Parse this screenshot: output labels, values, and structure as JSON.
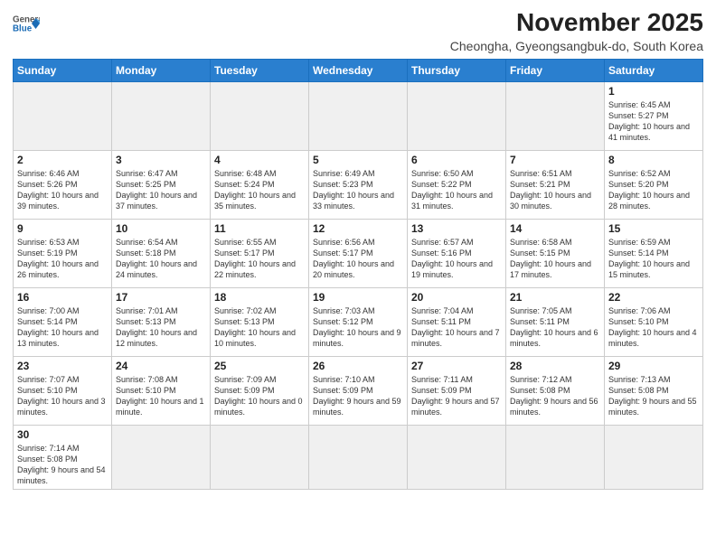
{
  "logo": {
    "general": "General",
    "blue": "Blue"
  },
  "header": {
    "month": "November 2025",
    "location": "Cheongha, Gyeongsangbuk-do, South Korea"
  },
  "weekdays": [
    "Sunday",
    "Monday",
    "Tuesday",
    "Wednesday",
    "Thursday",
    "Friday",
    "Saturday"
  ],
  "weeks": [
    [
      {
        "day": "",
        "empty": true
      },
      {
        "day": "",
        "empty": true
      },
      {
        "day": "",
        "empty": true
      },
      {
        "day": "",
        "empty": true
      },
      {
        "day": "",
        "empty": true
      },
      {
        "day": "",
        "empty": true
      },
      {
        "day": "1",
        "sunrise": "6:45 AM",
        "sunset": "5:27 PM",
        "daylight": "10 hours and 41 minutes."
      }
    ],
    [
      {
        "day": "2",
        "sunrise": "6:46 AM",
        "sunset": "5:26 PM",
        "daylight": "10 hours and 39 minutes."
      },
      {
        "day": "3",
        "sunrise": "6:47 AM",
        "sunset": "5:25 PM",
        "daylight": "10 hours and 37 minutes."
      },
      {
        "day": "4",
        "sunrise": "6:48 AM",
        "sunset": "5:24 PM",
        "daylight": "10 hours and 35 minutes."
      },
      {
        "day": "5",
        "sunrise": "6:49 AM",
        "sunset": "5:23 PM",
        "daylight": "10 hours and 33 minutes."
      },
      {
        "day": "6",
        "sunrise": "6:50 AM",
        "sunset": "5:22 PM",
        "daylight": "10 hours and 31 minutes."
      },
      {
        "day": "7",
        "sunrise": "6:51 AM",
        "sunset": "5:21 PM",
        "daylight": "10 hours and 30 minutes."
      },
      {
        "day": "8",
        "sunrise": "6:52 AM",
        "sunset": "5:20 PM",
        "daylight": "10 hours and 28 minutes."
      }
    ],
    [
      {
        "day": "9",
        "sunrise": "6:53 AM",
        "sunset": "5:19 PM",
        "daylight": "10 hours and 26 minutes."
      },
      {
        "day": "10",
        "sunrise": "6:54 AM",
        "sunset": "5:18 PM",
        "daylight": "10 hours and 24 minutes."
      },
      {
        "day": "11",
        "sunrise": "6:55 AM",
        "sunset": "5:17 PM",
        "daylight": "10 hours and 22 minutes."
      },
      {
        "day": "12",
        "sunrise": "6:56 AM",
        "sunset": "5:17 PM",
        "daylight": "10 hours and 20 minutes."
      },
      {
        "day": "13",
        "sunrise": "6:57 AM",
        "sunset": "5:16 PM",
        "daylight": "10 hours and 19 minutes."
      },
      {
        "day": "14",
        "sunrise": "6:58 AM",
        "sunset": "5:15 PM",
        "daylight": "10 hours and 17 minutes."
      },
      {
        "day": "15",
        "sunrise": "6:59 AM",
        "sunset": "5:14 PM",
        "daylight": "10 hours and 15 minutes."
      }
    ],
    [
      {
        "day": "16",
        "sunrise": "7:00 AM",
        "sunset": "5:14 PM",
        "daylight": "10 hours and 13 minutes."
      },
      {
        "day": "17",
        "sunrise": "7:01 AM",
        "sunset": "5:13 PM",
        "daylight": "10 hours and 12 minutes."
      },
      {
        "day": "18",
        "sunrise": "7:02 AM",
        "sunset": "5:13 PM",
        "daylight": "10 hours and 10 minutes."
      },
      {
        "day": "19",
        "sunrise": "7:03 AM",
        "sunset": "5:12 PM",
        "daylight": "10 hours and 9 minutes."
      },
      {
        "day": "20",
        "sunrise": "7:04 AM",
        "sunset": "5:11 PM",
        "daylight": "10 hours and 7 minutes."
      },
      {
        "day": "21",
        "sunrise": "7:05 AM",
        "sunset": "5:11 PM",
        "daylight": "10 hours and 6 minutes."
      },
      {
        "day": "22",
        "sunrise": "7:06 AM",
        "sunset": "5:10 PM",
        "daylight": "10 hours and 4 minutes."
      }
    ],
    [
      {
        "day": "23",
        "sunrise": "7:07 AM",
        "sunset": "5:10 PM",
        "daylight": "10 hours and 3 minutes."
      },
      {
        "day": "24",
        "sunrise": "7:08 AM",
        "sunset": "5:10 PM",
        "daylight": "10 hours and 1 minute."
      },
      {
        "day": "25",
        "sunrise": "7:09 AM",
        "sunset": "5:09 PM",
        "daylight": "10 hours and 0 minutes."
      },
      {
        "day": "26",
        "sunrise": "7:10 AM",
        "sunset": "5:09 PM",
        "daylight": "9 hours and 59 minutes."
      },
      {
        "day": "27",
        "sunrise": "7:11 AM",
        "sunset": "5:09 PM",
        "daylight": "9 hours and 57 minutes."
      },
      {
        "day": "28",
        "sunrise": "7:12 AM",
        "sunset": "5:08 PM",
        "daylight": "9 hours and 56 minutes."
      },
      {
        "day": "29",
        "sunrise": "7:13 AM",
        "sunset": "5:08 PM",
        "daylight": "9 hours and 55 minutes."
      }
    ],
    [
      {
        "day": "30",
        "sunrise": "7:14 AM",
        "sunset": "5:08 PM",
        "daylight": "9 hours and 54 minutes."
      },
      {
        "day": "",
        "empty": true
      },
      {
        "day": "",
        "empty": true
      },
      {
        "day": "",
        "empty": true
      },
      {
        "day": "",
        "empty": true
      },
      {
        "day": "",
        "empty": true
      },
      {
        "day": "",
        "empty": true
      }
    ]
  ]
}
